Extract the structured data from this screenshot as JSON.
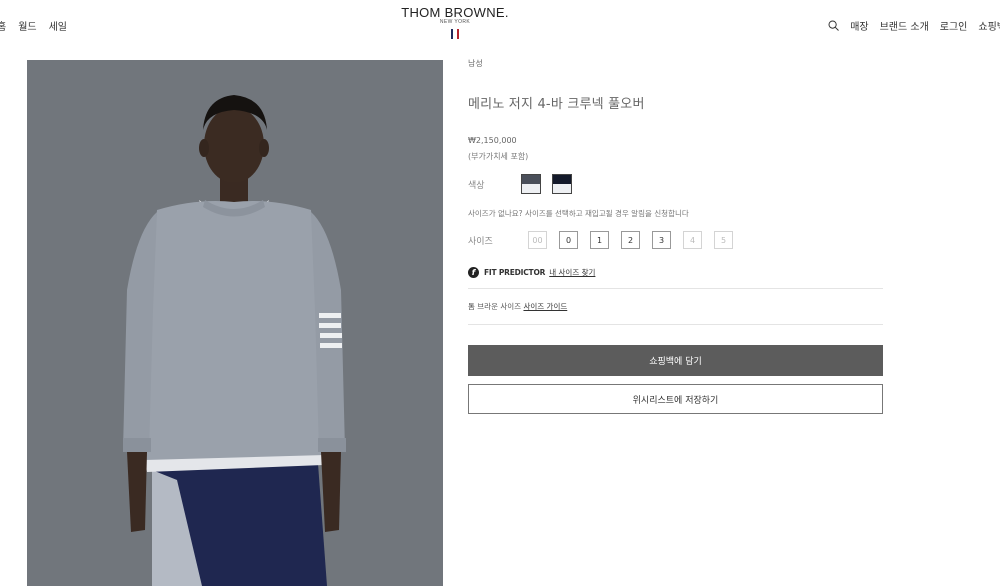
{
  "nav_left": [
    "홈",
    "월드",
    "세일"
  ],
  "logo": {
    "brand": "THOM BROWNE.",
    "sub": "NEW YORK",
    "flag_colors": [
      "#1f2a5c",
      "#ffffff",
      "#b3232e"
    ]
  },
  "nav_right": {
    "search_icon": "search-icon",
    "items": [
      "매장",
      "브랜드 소개",
      "로그인",
      "쇼핑백"
    ]
  },
  "product": {
    "gender": "남성",
    "name": "메리노 저지 4-바 크루넥 풀오버",
    "price": "₩2,150,000",
    "vat": "(부가가치세 포함)",
    "color_label": "색상",
    "colors": [
      {
        "name": "grey",
        "top": "#4a4f5a"
      },
      {
        "name": "navy",
        "top": "#141a2b"
      }
    ],
    "size_notice": "사이즈가 없나요? 사이즈를 선택하고 재입고될 경우 알림을 신청합니다",
    "size_label": "사이즈",
    "sizes": [
      {
        "label": "00",
        "available": false
      },
      {
        "label": "0",
        "available": true
      },
      {
        "label": "1",
        "available": true
      },
      {
        "label": "2",
        "available": true
      },
      {
        "label": "3",
        "available": true
      },
      {
        "label": "4",
        "available": false
      },
      {
        "label": "5",
        "available": false
      }
    ],
    "fit_predictor": "FIT PREDICTOR",
    "fit_link": "내 사이즈 찾기",
    "guide_prefix": "톰 브라운 사이즈",
    "guide_link": "사이즈 가이드",
    "add_to_bag": "쇼핑백에 담기",
    "save_wishlist": "위시리스트에 저장하기"
  }
}
